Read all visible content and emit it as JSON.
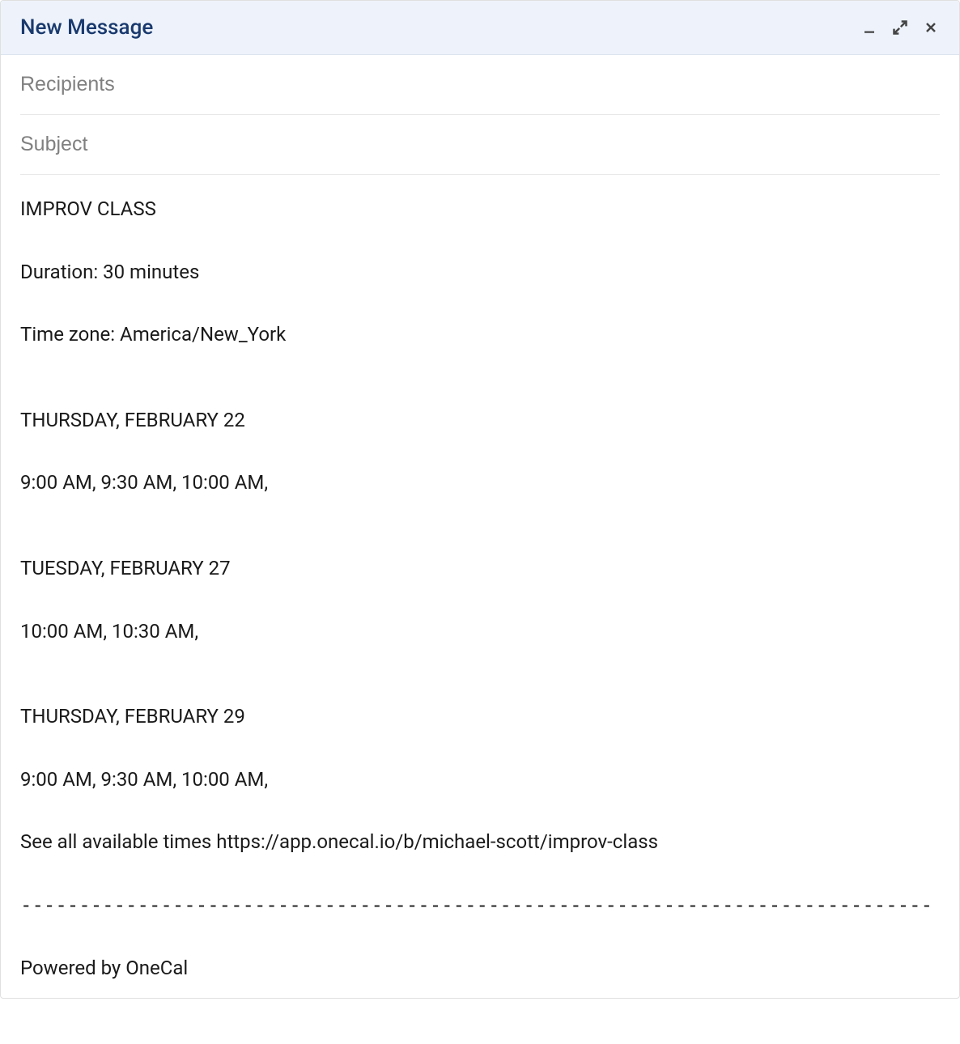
{
  "header": {
    "title": "New Message",
    "minimize_icon": "minimize",
    "expand_icon": "expand",
    "close_icon": "close"
  },
  "fields": {
    "recipients_placeholder": "Recipients",
    "recipients_value": "",
    "subject_placeholder": "Subject",
    "subject_value": ""
  },
  "body": {
    "title": "IMPROV CLASS",
    "duration": "Duration: 30 minutes",
    "timezone": "Time zone: America/New_York",
    "days": [
      {
        "date": "THURSDAY, FEBRUARY 22",
        "times": "9:00 AM, 9:30 AM, 10:00 AM,"
      },
      {
        "date": "TUESDAY, FEBRUARY 27",
        "times": "10:00 AM, 10:30 AM,"
      },
      {
        "date": "THURSDAY, FEBRUARY 29",
        "times": "9:00 AM, 9:30 AM, 10:00 AM,"
      }
    ],
    "see_all": "See all available times https://app.onecal.io/b/michael-scott/improv-class",
    "divider": "------------------------------------------------------------------------------",
    "powered_by": "Powered by OneCal"
  }
}
